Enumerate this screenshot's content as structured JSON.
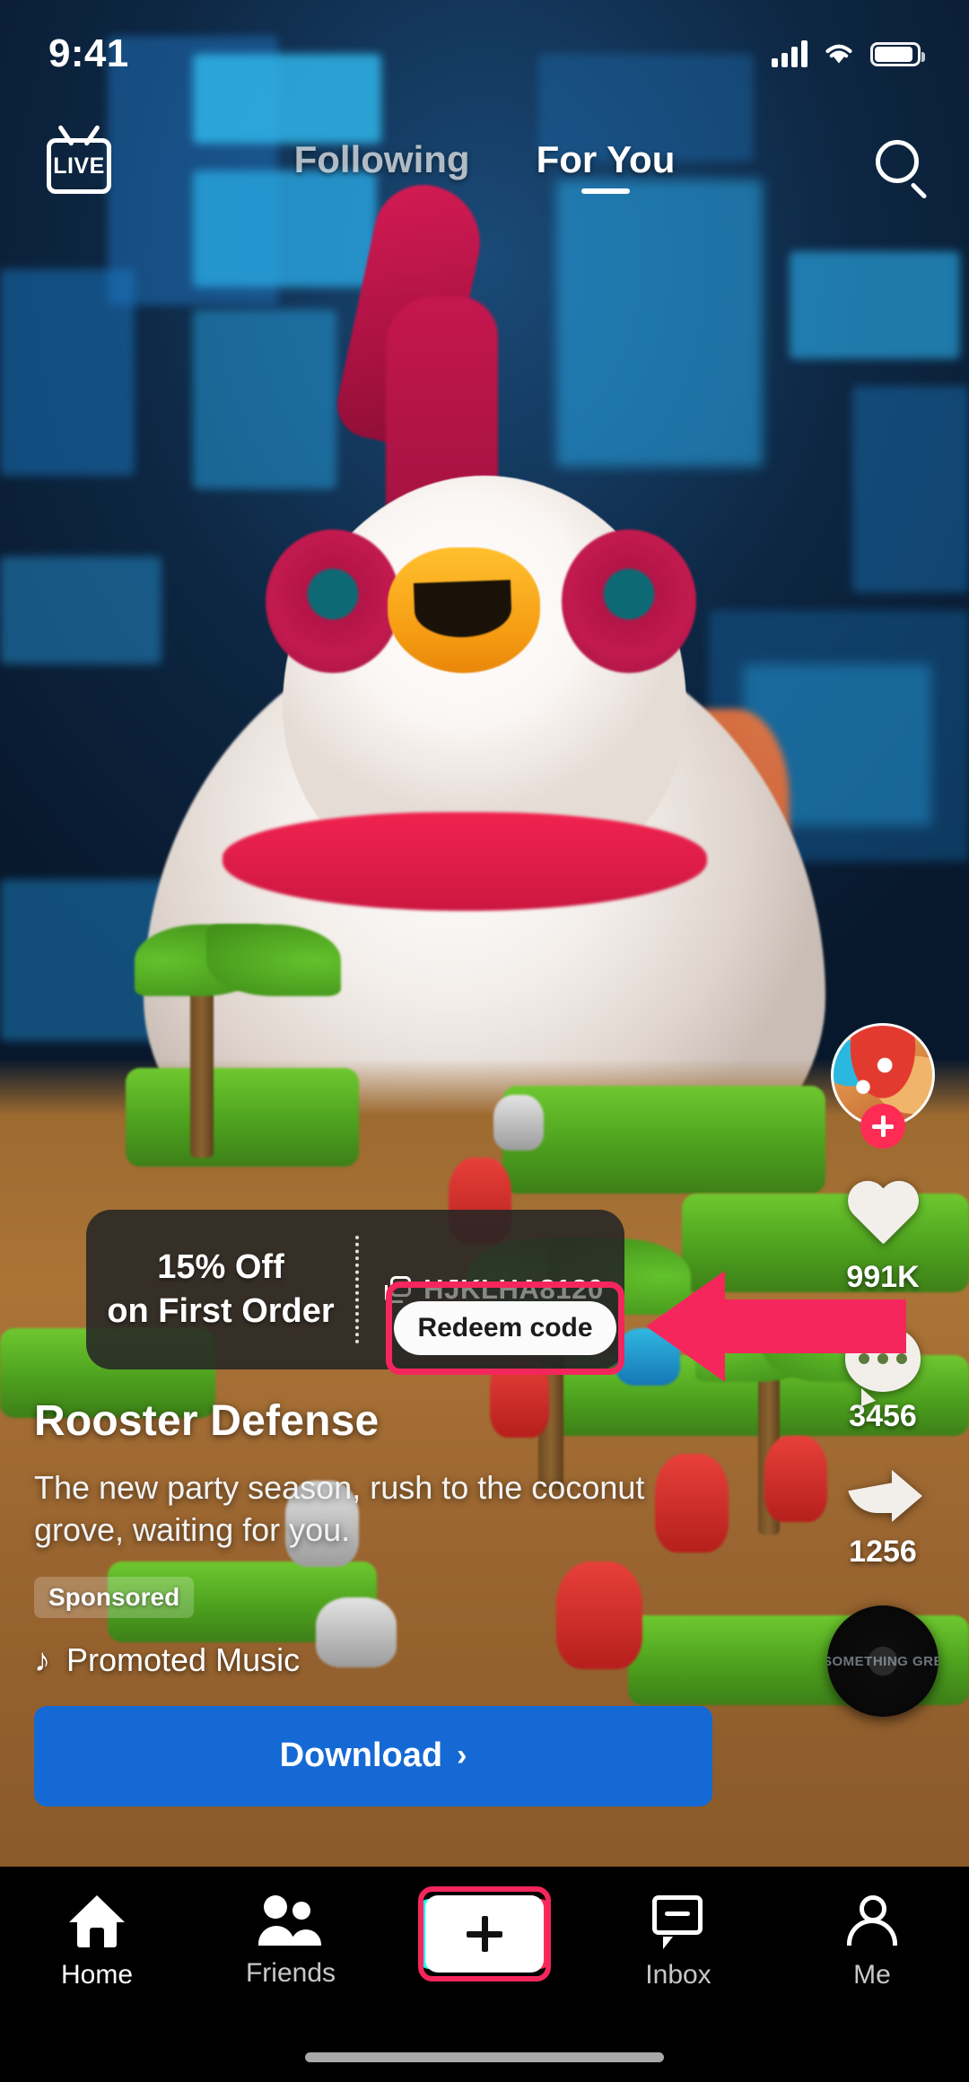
{
  "status_bar": {
    "time": "9:41",
    "signal_icon": "cellular-signal-icon",
    "wifi_icon": "wifi-icon",
    "battery_icon": "battery-icon"
  },
  "top_nav": {
    "live_label": "LIVE",
    "live_icon": "live-tv-icon",
    "tabs": [
      {
        "label": "Following",
        "active": false
      },
      {
        "label": "For You",
        "active": true
      }
    ],
    "search_icon": "search-icon"
  },
  "action_rail": {
    "avatar_name": "avatar",
    "follow_label": "+",
    "like": {
      "icon": "heart-icon",
      "count": "991K"
    },
    "comment": {
      "icon": "comment-icon",
      "count": "3456"
    },
    "share": {
      "icon": "share-icon",
      "count": "1256"
    },
    "disc_text": "SOMETHING GRE"
  },
  "promo_banner": {
    "offer_line1": "15% Off",
    "offer_line2": "on First Order",
    "copy_icon": "copy-icon",
    "code": "HJKLHA8120",
    "redeem_label": "Redeem code",
    "highlight_color": "#f5265c",
    "arrow_color": "#f5265c"
  },
  "caption": {
    "title": "Rooster Defense",
    "description": "The new party season, rush to the coconut grove, waiting for you.",
    "sponsored_label": "Sponsored",
    "music_icon": "music-note-icon",
    "music_title": "Promoted Music",
    "cta_label": "Download",
    "cta_chevron": "›",
    "cta_color": "#1569d4"
  },
  "bottom_nav": {
    "items": [
      {
        "label": "Home",
        "icon": "home-icon"
      },
      {
        "label": "Friends",
        "icon": "friends-icon"
      },
      {
        "label": "Inbox",
        "icon": "inbox-icon"
      },
      {
        "label": "Me",
        "icon": "profile-icon"
      }
    ],
    "create_icon": "plus-icon",
    "create_highlight_color": "#f5265c"
  }
}
